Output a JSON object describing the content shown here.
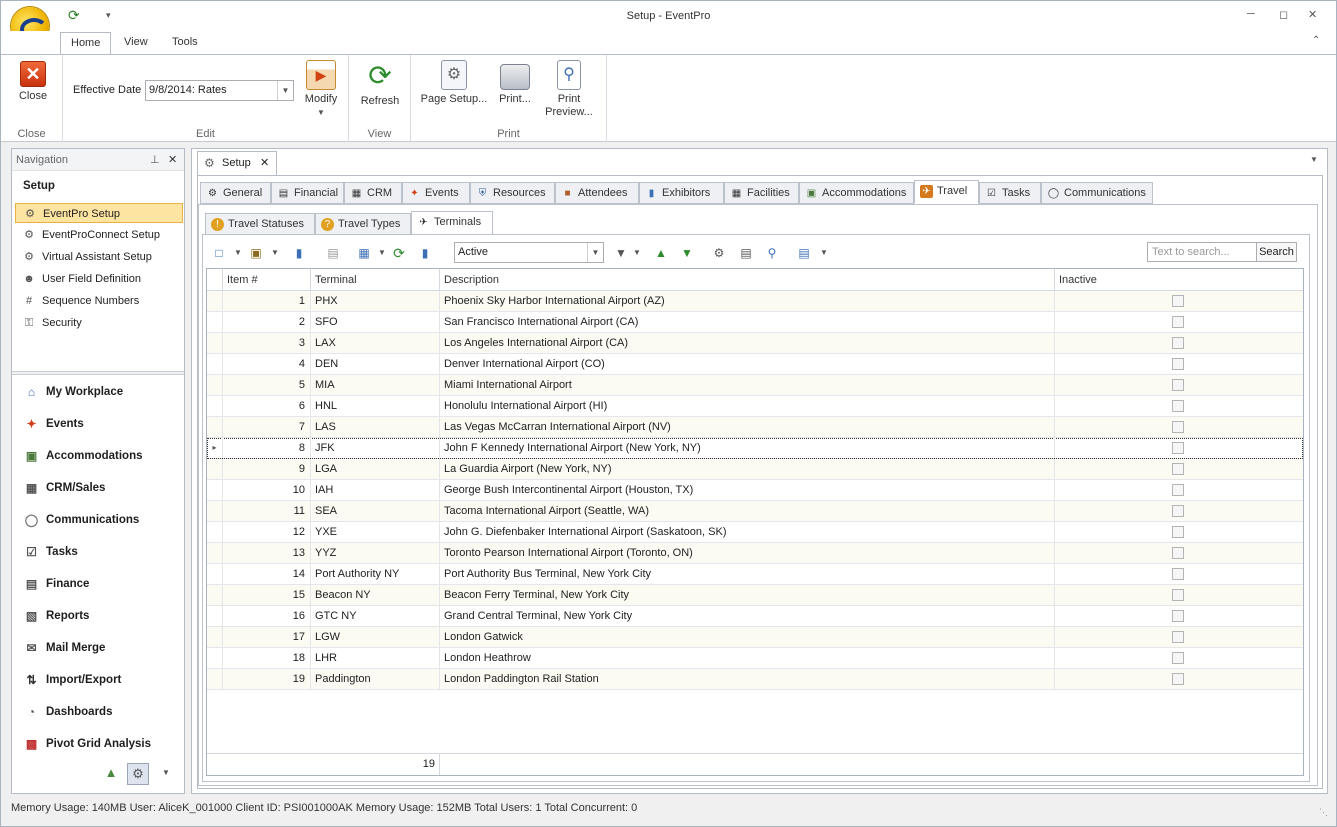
{
  "window": {
    "title": "Setup - EventPro"
  },
  "ribbon": {
    "tabs": [
      "Home",
      "View",
      "Tools"
    ],
    "groups": {
      "close": "Close",
      "edit": "Edit",
      "view": "View",
      "print": "Print"
    },
    "close_label": "Close",
    "effective_date_label": "Effective Date",
    "effective_date_value": "9/8/2014: Rates",
    "modify_label": "Modify",
    "refresh_label": "Refresh",
    "page_setup_label": "Page Setup...",
    "print_label": "Print...",
    "print_preview_label": "Print Preview..."
  },
  "nav": {
    "header": "Navigation",
    "section": "Setup",
    "items": [
      {
        "label": "EventPro Setup",
        "icon": "gear-icon"
      },
      {
        "label": "EventProConnect Setup",
        "icon": "gear-icon"
      },
      {
        "label": "Virtual Assistant Setup",
        "icon": "gear-icon"
      },
      {
        "label": "User Field Definition",
        "icon": "user-icon"
      },
      {
        "label": "Sequence Numbers",
        "icon": "hash-icon"
      },
      {
        "label": "Security",
        "icon": "lock-icon"
      }
    ],
    "modules": [
      {
        "label": "My Workplace",
        "icon": "home-icon"
      },
      {
        "label": "Events",
        "icon": "pin-icon"
      },
      {
        "label": "Accommodations",
        "icon": "bed-icon"
      },
      {
        "label": "CRM/Sales",
        "icon": "crm-icon"
      },
      {
        "label": "Communications",
        "icon": "speech-bubble-icon"
      },
      {
        "label": "Tasks",
        "icon": "clipboard-icon"
      },
      {
        "label": "Finance",
        "icon": "finance-icon"
      },
      {
        "label": "Reports",
        "icon": "report-icon"
      },
      {
        "label": "Mail Merge",
        "icon": "mail-merge-icon"
      },
      {
        "label": "Import/Export",
        "icon": "import-export-icon"
      },
      {
        "label": "Dashboards",
        "icon": "dashboard-icon"
      },
      {
        "label": "Pivot Grid Analysis",
        "icon": "pivot-icon"
      }
    ]
  },
  "doc_tab": {
    "label": "Setup"
  },
  "setup_tabs": [
    "General",
    "Financial",
    "CRM",
    "Events",
    "Resources",
    "Attendees",
    "Exhibitors",
    "Facilities",
    "Accommodations",
    "Travel",
    "Tasks",
    "Communications"
  ],
  "travel_tabs": [
    "Travel Statuses",
    "Travel Types",
    "Terminals"
  ],
  "toolbar": {
    "filter_value": "Active",
    "search_placeholder": "Text to search...",
    "search_button": "Search"
  },
  "grid": {
    "columns": [
      "Item #",
      "Terminal",
      "Description",
      "Inactive"
    ],
    "rows": [
      {
        "item": "1",
        "terminal": "PHX",
        "description": "Phoenix Sky Harbor International Airport (AZ)"
      },
      {
        "item": "2",
        "terminal": "SFO",
        "description": "San Francisco International Airport (CA)"
      },
      {
        "item": "3",
        "terminal": "LAX",
        "description": "Los Angeles International Airport (CA)"
      },
      {
        "item": "4",
        "terminal": "DEN",
        "description": "Denver International Airport (CO)"
      },
      {
        "item": "5",
        "terminal": "MIA",
        "description": "Miami International Airport"
      },
      {
        "item": "6",
        "terminal": "HNL",
        "description": "Honolulu International Airport (HI)"
      },
      {
        "item": "7",
        "terminal": "LAS",
        "description": "Las Vegas McCarran International Airport (NV)"
      },
      {
        "item": "8",
        "terminal": "JFK",
        "description": "John F Kennedy International Airport (New York, NY)"
      },
      {
        "item": "9",
        "terminal": "LGA",
        "description": "La Guardia Airport (New York, NY)"
      },
      {
        "item": "10",
        "terminal": "IAH",
        "description": "George Bush Intercontinental Airport (Houston, TX)"
      },
      {
        "item": "11",
        "terminal": "SEA",
        "description": "Tacoma International Airport (Seattle, WA)"
      },
      {
        "item": "12",
        "terminal": "YXE",
        "description": "John G. Diefenbaker International Airport (Saskatoon, SK)"
      },
      {
        "item": "13",
        "terminal": "YYZ",
        "description": "Toronto Pearson International Airport (Toronto, ON)"
      },
      {
        "item": "14",
        "terminal": "Port Authority NY",
        "description": "Port Authority Bus Terminal, New York City"
      },
      {
        "item": "15",
        "terminal": "Beacon NY",
        "description": "Beacon Ferry Terminal, New York City"
      },
      {
        "item": "16",
        "terminal": "GTC NY",
        "description": "Grand Central Terminal, New York City"
      },
      {
        "item": "17",
        "terminal": "LGW",
        "description": "London Gatwick"
      },
      {
        "item": "18",
        "terminal": "LHR",
        "description": "London Heathrow"
      },
      {
        "item": "19",
        "terminal": "Paddington",
        "description": "London Paddington Rail Station"
      }
    ],
    "footer_count": "19"
  },
  "status": "Memory Usage: 140MB   User: AliceK_001000   Client ID: PSI001000AK   Memory Usage: 152MB   Total Users: 1   Total Concurrent: 0"
}
